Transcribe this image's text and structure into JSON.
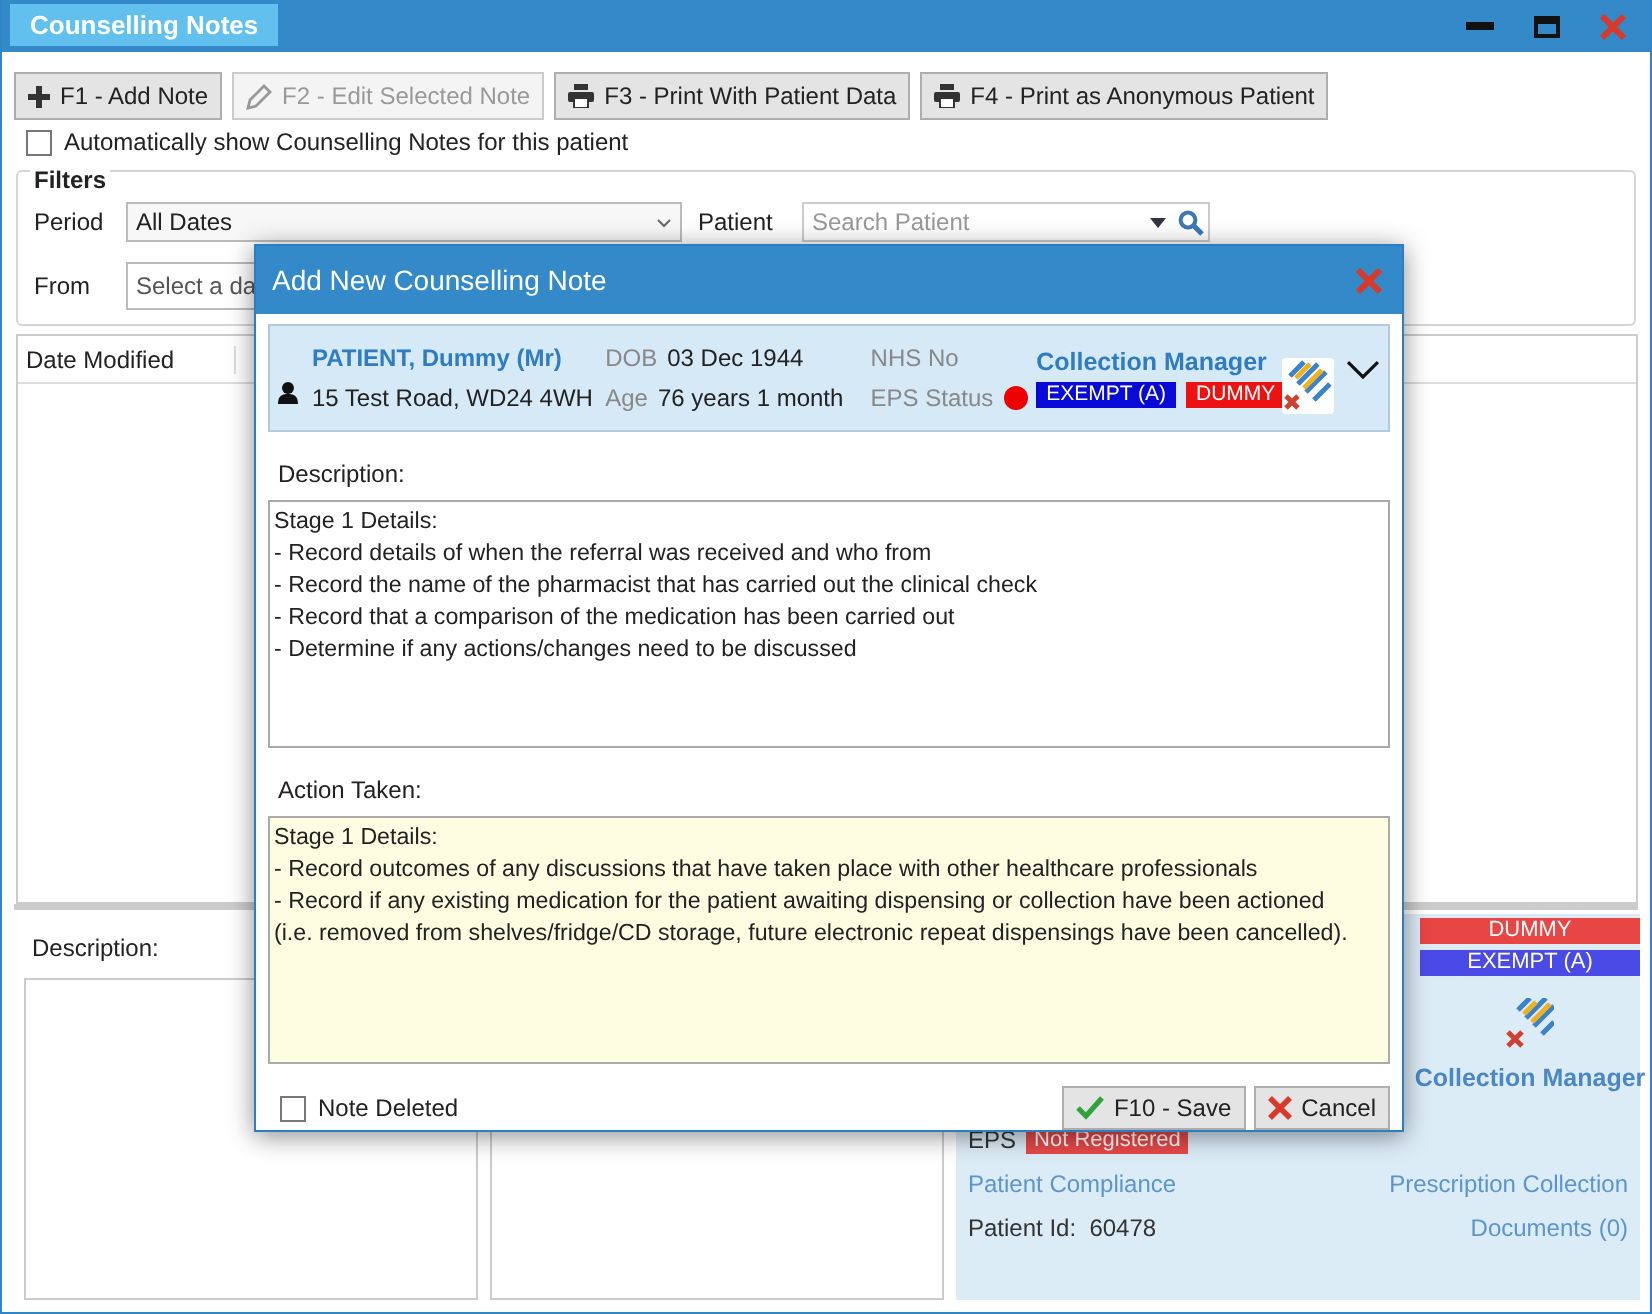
{
  "window": {
    "title": "Counselling Notes"
  },
  "toolbar": [
    {
      "label": "F1 - Add Note",
      "disabled": false
    },
    {
      "label": "F2 - Edit Selected Note",
      "disabled": true
    },
    {
      "label": "F3 - Print With Patient Data",
      "disabled": false
    },
    {
      "label": "F4 - Print as Anonymous Patient",
      "disabled": false
    }
  ],
  "auto_show": {
    "label": "Automatically show Counselling Notes for this patient",
    "checked": false
  },
  "filters": {
    "title": "Filters",
    "period_label": "Period",
    "period_value": "All Dates",
    "patient_label": "Patient",
    "patient_placeholder": "Search Patient",
    "from_label": "From",
    "from_placeholder": "Select a da"
  },
  "table": {
    "columns": [
      "Date Modified"
    ]
  },
  "details": {
    "description_label": "Description:"
  },
  "patient_panel": {
    "badges": [
      {
        "label": "DUMMY",
        "color": "#e84545"
      },
      {
        "label": "EXEMPT (A)",
        "color": "#4a4ae6"
      }
    ],
    "collection_manager": "Collection Manager",
    "eps_label": "EPS",
    "eps_status": "Not Registered",
    "compliance_link": "Patient Compliance",
    "collection_link": "Prescription Collection",
    "patient_id_label": "Patient Id:",
    "patient_id": "60478",
    "documents_link": "Documents (0)"
  },
  "dialog": {
    "title": "Add New Counselling Note",
    "patient": {
      "name": "PATIENT, Dummy (Mr)",
      "address": "15 Test Road, WD24 4WH",
      "dob_label": "DOB",
      "dob": "03 Dec 1944",
      "age_label": "Age",
      "age": "76 years 1 month",
      "nhs_label": "NHS No",
      "eps_label": "EPS Status",
      "collection_manager": "Collection Manager",
      "badges": [
        {
          "label": "EXEMPT (A)",
          "color": "#0a0ad8"
        },
        {
          "label": "DUMMY",
          "color": "#ee1111"
        }
      ]
    },
    "description_label": "Description:",
    "description": [
      "Stage 1 Details:",
      "- Record details of when the referral was received and who from",
      "- Record the name of the pharmacist that has carried out the clinical check",
      "- Record that a comparison of the medication has been carried out",
      "- Determine if any actions/changes need to be discussed"
    ],
    "action_label": "Action Taken:",
    "action": [
      "Stage 1 Details:",
      "- Record outcomes of any discussions that have taken place with other healthcare professionals",
      "- Record if any existing medication for the patient awaiting dispensing or collection have been actioned",
      "(i.e. removed from shelves/fridge/CD storage, future electronic repeat dispensings have been cancelled)."
    ],
    "note_deleted": {
      "label": "Note Deleted",
      "checked": false
    },
    "buttons": [
      {
        "label": "F10 - Save"
      },
      {
        "label": "Cancel"
      }
    ]
  }
}
